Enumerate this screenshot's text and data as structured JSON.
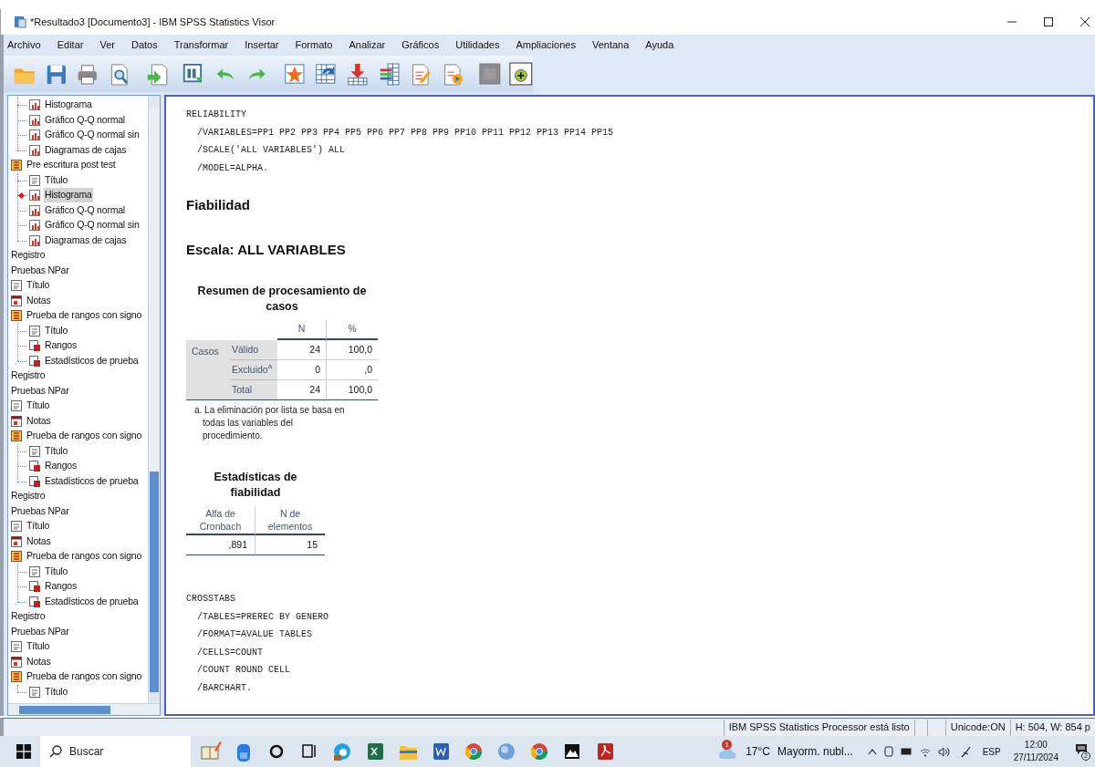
{
  "window": {
    "title": "*Resultado3 [Documento3] - IBM SPSS Statistics Visor"
  },
  "menu": [
    "Archivo",
    "Editar",
    "Ver",
    "Datos",
    "Transformar",
    "Insertar",
    "Formato",
    "Analizar",
    "Gráficos",
    "Utilidades",
    "Ampliaciones",
    "Ventana",
    "Ayuda"
  ],
  "outline": [
    {
      "children": [
        {
          "label": "Histograma",
          "kind": "chart",
          "selected": false
        },
        {
          "label": "Gráfico Q-Q normal",
          "kind": "chart",
          "selected": false
        },
        {
          "label": "Gráfico Q-Q normal sin",
          "kind": "chart",
          "selected": false
        },
        {
          "label": "Diagramas de cajas",
          "kind": "chart",
          "selected": false
        }
      ]
    },
    {
      "label": "Pre escritura post test",
      "kind": "procedure",
      "selected": false,
      "children": [
        {
          "label": "Título",
          "kind": "title",
          "selected": false
        },
        {
          "label": "Histograma",
          "kind": "chart",
          "selected": true
        },
        {
          "label": "Gráfico Q-Q normal",
          "kind": "chart",
          "selected": false
        },
        {
          "label": "Gráfico Q-Q normal sin",
          "kind": "chart",
          "selected": false
        },
        {
          "label": "Diagramas de cajas",
          "kind": "chart",
          "selected": false
        }
      ]
    },
    {
      "label": "Registro",
      "kind": "log",
      "selected": false
    },
    {
      "label": "Pruebas NPar",
      "kind": "log",
      "selected": false
    },
    {
      "label": "Título",
      "kind": "title",
      "selected": false
    },
    {
      "label": "Notas",
      "kind": "notes",
      "selected": false
    },
    {
      "label": "Prueba de rangos con signo",
      "kind": "procedure",
      "selected": false,
      "children": [
        {
          "label": "Título",
          "kind": "title",
          "selected": false
        },
        {
          "label": "Rangos",
          "kind": "table",
          "selected": false
        },
        {
          "label": "Estadísticos de prueba",
          "kind": "table",
          "selected": false
        }
      ]
    },
    {
      "label": "Registro",
      "kind": "log",
      "selected": false
    },
    {
      "label": "Pruebas NPar",
      "kind": "log",
      "selected": false
    },
    {
      "label": "Título",
      "kind": "title",
      "selected": false
    },
    {
      "label": "Notas",
      "kind": "notes",
      "selected": false
    },
    {
      "label": "Prueba de rangos con signo",
      "kind": "procedure",
      "selected": false,
      "children": [
        {
          "label": "Título",
          "kind": "title",
          "selected": false
        },
        {
          "label": "Rangos",
          "kind": "table",
          "selected": false
        },
        {
          "label": "Estadísticos de prueba",
          "kind": "table",
          "selected": false
        }
      ]
    },
    {
      "label": "Registro",
      "kind": "log",
      "selected": false
    },
    {
      "label": "Pruebas NPar",
      "kind": "log",
      "selected": false
    },
    {
      "label": "Título",
      "kind": "title",
      "selected": false
    },
    {
      "label": "Notas",
      "kind": "notes",
      "selected": false
    },
    {
      "label": "Prueba de rangos con signo",
      "kind": "procedure",
      "selected": false,
      "children": [
        {
          "label": "Título",
          "kind": "title",
          "selected": false
        },
        {
          "label": "Rangos",
          "kind": "table",
          "selected": false
        },
        {
          "label": "Estadísticos de prueba",
          "kind": "table",
          "selected": false
        }
      ]
    },
    {
      "label": "Registro",
      "kind": "log",
      "selected": false
    },
    {
      "label": "Pruebas NPar",
      "kind": "log",
      "selected": false
    },
    {
      "label": "Título",
      "kind": "title",
      "selected": false
    },
    {
      "label": "Notas",
      "kind": "notes",
      "selected": false
    },
    {
      "label": "Prueba de rangos con signo",
      "kind": "procedure",
      "selected": false,
      "children": [
        {
          "label": "Título",
          "kind": "title",
          "selected": false
        }
      ]
    }
  ],
  "output": [
    {
      "kind": "syntax",
      "lines": [
        "RELIABILITY",
        "  /VARIABLES=PP1 PP2 PP3 PP4 PP5 PP6 PP7 PP8 PP9 PP10 PP11 PP12 PP13 PP14 PP15",
        "  /SCALE('ALL VARIABLES') ALL",
        "  /MODEL=ALPHA."
      ]
    },
    {
      "kind": "heading",
      "text": "Fiabilidad"
    },
    {
      "kind": "heading",
      "text": "Escala: ALL VARIABLES"
    },
    {
      "kind": "summary_table",
      "title": "Resumen de procesamiento de casos",
      "columns": [
        "N",
        "%"
      ],
      "group": "Casos",
      "rows": [
        {
          "label": "Válido",
          "values": [
            "24",
            "100,0"
          ]
        },
        {
          "label": "Excluido$^{a}$",
          "values": [
            "0",
            ",0"
          ]
        },
        {
          "label": "Total",
          "values": [
            "24",
            "100,0"
          ]
        }
      ],
      "footnote": "a. La eliminación por lista se basa en todas las variables del procedimiento."
    },
    {
      "kind": "stats_table",
      "title": "Estadísticas de fiabilidad",
      "columns": [
        "Alfa de Cronbach",
        "N de elementos"
      ],
      "rows": [
        [
          ",891",
          "15"
        ]
      ]
    },
    {
      "kind": "syntax",
      "lines": [
        "CROSSTABS",
        "  /TABLES=PREREC BY GENERO",
        "  /FORMAT=AVALUE TABLES",
        "  /CELLS=COUNT",
        "  /COUNT ROUND CELL",
        "  /BARCHART."
      ]
    }
  ],
  "status_bar": [
    "IBM SPSS Statistics Processor está listo",
    "Unicode:ON",
    "H: 504, W: 854 p"
  ],
  "taskbar": {
    "search": {
      "placeholder": "Buscar"
    },
    "weather_badge": "1",
    "temperature": "17°C",
    "weather": "Mayorm. nubl...",
    "language": "ESP",
    "time": "12:00",
    "date": "27/11/2024",
    "notifications": "2"
  }
}
